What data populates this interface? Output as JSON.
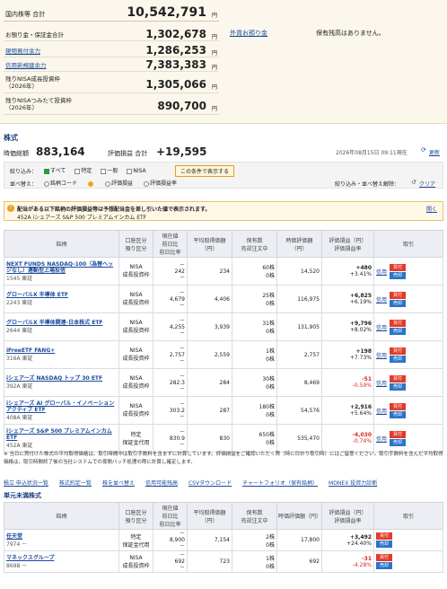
{
  "summary": {
    "total_label": "国内株等 合計",
    "total_value": "10,542,791",
    "yen": "円",
    "rows": [
      {
        "label": "お預り金・保証金合計",
        "value": "1,302,678",
        "link": false
      },
      {
        "label": "現物買付余力",
        "value": "1,286,253",
        "link": true
      },
      {
        "label": "信用新規建余力",
        "value": "7,383,383",
        "link": true
      },
      {
        "label": "残りNISA成長投資枠\n（2026年）",
        "value": "1,305,066",
        "link": false
      },
      {
        "label": "残りNISAつみたて投資枠\n（2026年）",
        "value": "890,700",
        "link": false
      }
    ],
    "fx_link": "外貨お預り金",
    "fx_note": "保有残高はありません。"
  },
  "stocks": {
    "title": "株式",
    "mv_label": "時価総額",
    "mv_value": "883,164",
    "pl_label": "評価損益 合計",
    "pl_value": "+19,595",
    "timestamp": "2026年08月15日 09:11現在",
    "refresh": "更新",
    "filter_label": "絞り込み：",
    "filters": [
      {
        "label": "すべて",
        "on": true
      },
      {
        "label": "特定",
        "on": false
      },
      {
        "label": "一般",
        "on": false
      },
      {
        "label": "NISA",
        "on": false
      }
    ],
    "filter_show": "この条件で表示する",
    "sort_label": "並べ替え：",
    "sorts": [
      {
        "label": "銘柄コード",
        "on": false
      },
      {
        "label": "",
        "on": true
      },
      {
        "label": "評価損益",
        "on": false
      },
      {
        "label": "評価損益率",
        "on": false
      }
    ],
    "reset_label": "絞り込み・並べ替え解除：",
    "clear": "クリア"
  },
  "notice": {
    "text": "配当がある以下銘柄の評価損益等は予想配当金を差し引いた値で表示されます。",
    "fund": "452A iシェアーズ S&P 500 プレミアムインカム ETF",
    "open": "開く"
  },
  "holdings_headers": [
    "銘柄",
    "口座区分\n預り区分",
    "現在値\n前日比\n前日比率",
    "平均取得価額\n（円）",
    "保有数\n売却注文中",
    "時価評価額\n（円）",
    "評価損益（円）\n評価損益率",
    "取引"
  ],
  "holdings": [
    {
      "name": "NEXT FUNDS NASDAQ-100（為替ヘッジなし）連動型上場投信",
      "code": "1545 東証",
      "acct": "NISA\n成長投資枠",
      "price": "242",
      "avg": "234",
      "qty": "60株\n0株",
      "mv": "14,520",
      "pl": "+480",
      "plr": "+3.41%",
      "neg": false
    },
    {
      "name": "グローバルX 半導体 ETF",
      "code": "2243 東証",
      "acct": "NISA\n成長投資枠",
      "price": "4,679",
      "avg": "4,406",
      "qty": "25株\n0株",
      "mv": "116,975",
      "pl": "+6,825",
      "plr": "+6.19%",
      "neg": false
    },
    {
      "name": "グローバルX 半導体関連-日本株式 ETF",
      "code": "2644 東証",
      "acct": "NISA\n成長投資枠",
      "price": "4,255",
      "avg": "3,939",
      "qty": "31株\n0株",
      "mv": "131,905",
      "pl": "+9,796",
      "plr": "+8.02%",
      "neg": false
    },
    {
      "name": "iFreeETF FANG+",
      "code": "316A 東証",
      "acct": "NISA\n成長投資枠",
      "price": "2,757",
      "avg": "2,559",
      "qty": "1株\n0株",
      "mv": "2,757",
      "pl": "+198",
      "plr": "+7.73%",
      "neg": false
    },
    {
      "name": "iシェアーズ NASDAQ トップ 30 ETF",
      "code": "392A 東証",
      "acct": "NISA\n成長投資枠",
      "price": "282.3",
      "avg": "284",
      "qty": "30株\n0株",
      "mv": "8,469",
      "pl": "-51",
      "plr": "-0.59%",
      "neg": true
    },
    {
      "name": "iシェアーズ AI グローバル・イノベーション アクティブ ETF",
      "code": "408A 東証",
      "acct": "NISA\n成長投資枠",
      "price": "303.2",
      "avg": "287",
      "qty": "180株\n0株",
      "mv": "54,576",
      "pl": "+2,916",
      "plr": "+5.64%",
      "neg": false
    },
    {
      "name": "iシェアーズ S&P 500 プレミアムインカム ETF",
      "code": "452A 東証",
      "acct": "特定\n保証金代用",
      "price": "830.9",
      "avg": "830",
      "qty": "650株\n0株",
      "mv": "535,470",
      "pl": "-4,030",
      "plr": "-0.74%",
      "neg": true
    }
  ],
  "labels": {
    "credit": "信用",
    "buy": "買付",
    "sell": "売却",
    "dash": "－"
  },
  "footnote": "※ 当日に買付けた株式の平均取得価格は、取引時間中は取引手数料を含まずに計算しています。評価損益をご確認いただく際（特に日計り取引時）にはご留意ください。取引手数料を含んだ平均取得価格は、取引時間終了後の当社システムでの夜間バッチ処理の際に計算し確定します。",
  "links": [
    "積立 申込状況一覧",
    "株式約定一覧",
    "株を並べ替え",
    "信用可能残高",
    "CSVダウンロード",
    "チャートフォリオ（保有銘柄）",
    "MONEX 投資力診断"
  ],
  "unsettled": {
    "title": "単元未満株式",
    "headers": [
      "銘柄",
      "口座区分\n預り区分",
      "現在値\n前日比\n前日比率",
      "平均取得価額（円）",
      "保有数\n売却注文中",
      "時価評価額（円）",
      "評価損益（円）\n評価損益率",
      "取引"
    ],
    "rows": [
      {
        "name": "任天堂",
        "code": "7974 －",
        "acct": "特定\n保証金代用",
        "price": "8,900",
        "avg": "7,154",
        "qty": "2株\n0株",
        "mv": "17,800",
        "pl": "+3,492",
        "plr": "+24.40%",
        "neg": false
      },
      {
        "name": "マネックスグループ",
        "code": "8698 －",
        "acct": "NISA\n成長投資枠",
        "price": "692",
        "avg": "723",
        "qty": "1株\n0株",
        "mv": "692",
        "pl": "-31",
        "plr": "-4.28%",
        "neg": true
      }
    ]
  }
}
